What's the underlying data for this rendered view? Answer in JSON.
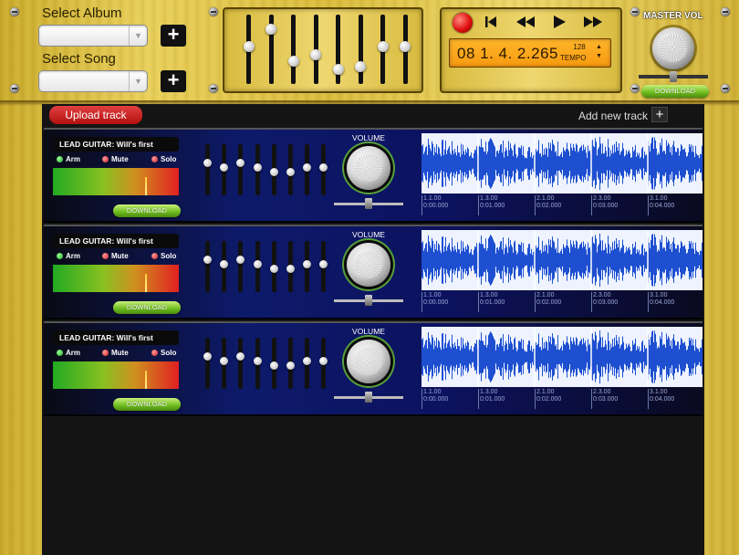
{
  "header": {
    "select_album_label": "Select Album",
    "select_song_label": "Select Song",
    "album_value": "",
    "song_value": "",
    "add_label": "+"
  },
  "eq": {
    "levels": [
      0.55,
      0.85,
      0.3,
      0.4,
      0.15,
      0.2,
      0.55,
      0.55
    ]
  },
  "transport": {
    "time": "08 1. 4. 2.265",
    "tempo_value": "128",
    "tempo_label": "TEMPO",
    "prev_icon": "skip-back-icon",
    "rewind_icon": "rewind-icon",
    "play_icon": "play-icon",
    "forward_icon": "fast-forward-icon",
    "record_icon": "record-icon"
  },
  "master": {
    "label": "MASTER VOL",
    "download_label": "DOWNLOAD"
  },
  "toolbar": {
    "upload_label": "Upload track",
    "add_track_label": "Add new track",
    "add_track_plus": "+"
  },
  "tracks": [
    {
      "name": "LEAD GUITAR: Will's first",
      "arm": "Arm",
      "mute": "Mute",
      "solo": "Solo",
      "download_label": "DOWNLOAD",
      "volume_label": "VOLUME",
      "eq_levels": [
        0.65,
        0.55,
        0.65,
        0.55,
        0.45,
        0.45,
        0.55,
        0.55
      ],
      "ruler": [
        [
          "1.1.00",
          "0:00.000"
        ],
        [
          "1.3.00",
          "0:01.000"
        ],
        [
          "2.1.00",
          "0:02.000"
        ],
        [
          "2.3.00",
          "0:03.000"
        ],
        [
          "3.1.00",
          "0:04.000"
        ]
      ]
    },
    {
      "name": "LEAD GUITAR: Will's first",
      "arm": "Arm",
      "mute": "Mute",
      "solo": "Solo",
      "download_label": "DOWNLOAD",
      "volume_label": "VOLUME",
      "eq_levels": [
        0.65,
        0.55,
        0.65,
        0.55,
        0.45,
        0.45,
        0.55,
        0.55
      ],
      "ruler": [
        [
          "1.1.00",
          "0:00.000"
        ],
        [
          "1.3.00",
          "0:01.000"
        ],
        [
          "2.1.00",
          "0:02.000"
        ],
        [
          "2.3.00",
          "0:03.000"
        ],
        [
          "3.1.00",
          "0:04.000"
        ]
      ]
    },
    {
      "name": "LEAD GUITAR: Will's first",
      "arm": "Arm",
      "mute": "Mute",
      "solo": "Solo",
      "download_label": "DOWNLOAD",
      "volume_label": "VOLUME",
      "eq_levels": [
        0.65,
        0.55,
        0.65,
        0.55,
        0.45,
        0.45,
        0.55,
        0.55
      ],
      "ruler": [
        [
          "1.1.00",
          "0:00.000"
        ],
        [
          "1.3.00",
          "0:01.000"
        ],
        [
          "2.1.00",
          "0:02.000"
        ],
        [
          "2.3.00",
          "0:03.000"
        ],
        [
          "3.1.00",
          "0:04.000"
        ]
      ]
    }
  ],
  "colors": {
    "wood": "#e2c84e",
    "track_bg": "#0d1a6a",
    "waveform": "#1d4fd0",
    "upload_btn": "#c41818",
    "download_btn": "#6dbb1e",
    "lcd": "#f9a31a"
  }
}
